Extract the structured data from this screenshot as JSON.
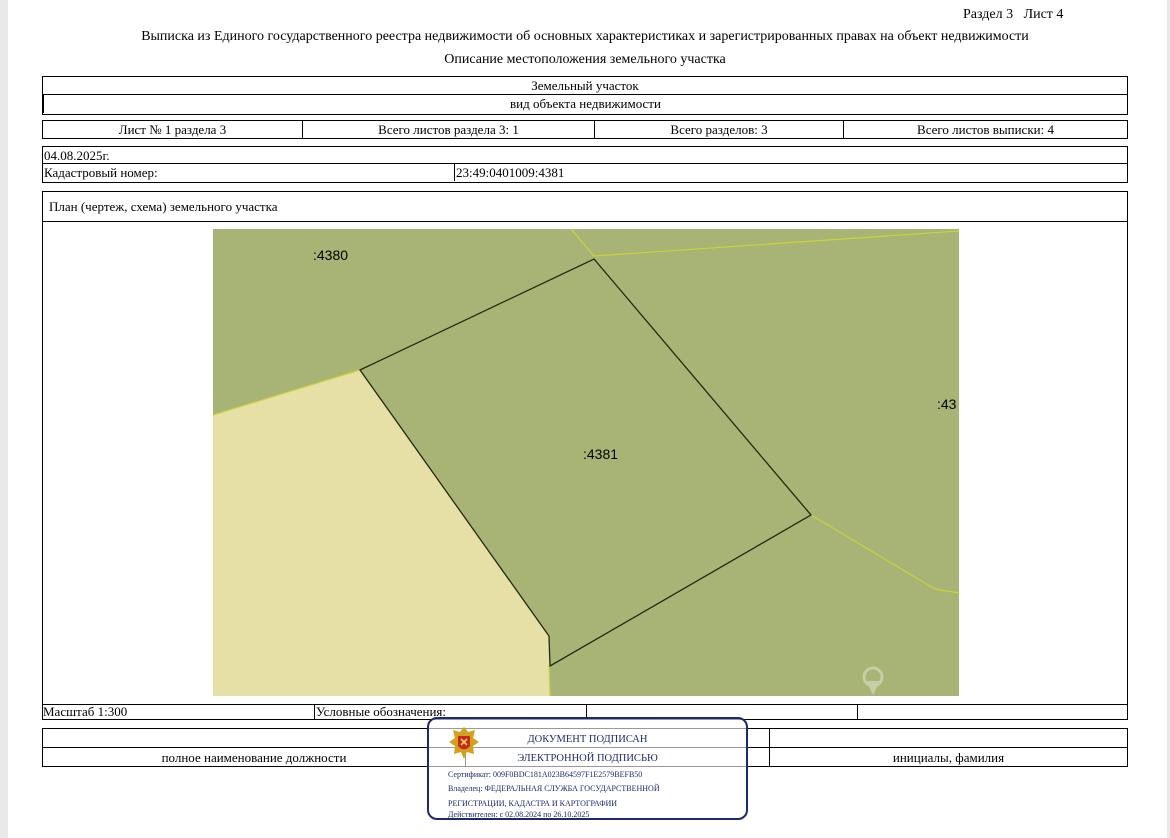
{
  "header": {
    "section": "Раздел 3",
    "sheet": "Лист 4",
    "title": "Выписка из Единого государственного реестра недвижимости об основных характеристиках и зарегистрированных правах на объект недвижимости",
    "subtitle": "Описание местоположения земельного участка"
  },
  "object": {
    "type": "Земельный участок",
    "type_caption": "вид объекта недвижимости"
  },
  "sheets": {
    "sheet_no": "Лист № 1 раздела 3",
    "total_section_sheets": "Всего листов раздела 3: 1",
    "total_sections": "Всего разделов: 3",
    "total_extract_sheets": "Всего листов выписки: 4"
  },
  "info": {
    "date": "04.08.2025г.",
    "cadastral_label": "Кадастровый номер:",
    "cadastral_value": "23:49:0401009:4381"
  },
  "plan": {
    "title": "План (чертеж, схема) земельного участка",
    "labels": {
      "neighbor_top": ":4380",
      "parcel": ":4381",
      "neighbor_right": ":43"
    },
    "colors": {
      "parcel": "#a8b475",
      "neighbor": "#a8b475",
      "other": "#e6e0a7",
      "boundary": "#c9d43a"
    }
  },
  "footer": {
    "scale": "Масштаб 1:300",
    "legend": "Условные обозначения:",
    "position_caption": "полное наименование должности",
    "name_caption": "инициалы, фамилия"
  },
  "signature": {
    "line1": "ДОКУМЕНТ ПОДПИСАН",
    "line2": "ЭЛЕКТРОННОЙ ПОДПИСЬЮ",
    "certificate": "Сертификат: 009F0BDC181A023B64597F1E2579BEFB50",
    "owner1": "Владелец: ФЕДЕРАЛЬНАЯ СЛУЖБА ГОСУДАРСТВЕННОЙ",
    "owner2": "РЕГИСТРАЦИИ, КАДАСТРА И КАРТОГРАФИИ",
    "valid": "Действителен: с 02.08.2024 по 26.10.2025",
    "border_color": "#1d2a6e"
  }
}
